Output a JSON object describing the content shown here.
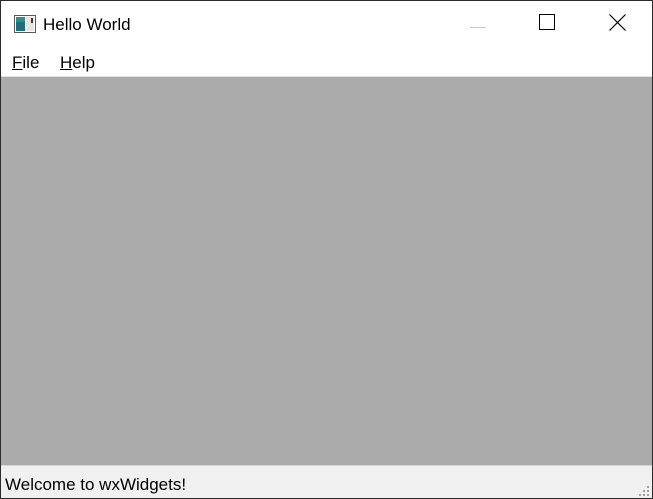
{
  "window": {
    "title": "Hello World",
    "app_icon": "app-window-icon",
    "controls": {
      "minimize_icon": "minimize-icon",
      "maximize_icon": "maximize-icon",
      "close_icon": "close-icon"
    }
  },
  "menubar": {
    "items": [
      {
        "mnemonic": "F",
        "rest": "ile"
      },
      {
        "mnemonic": "H",
        "rest": "elp"
      }
    ]
  },
  "client": {
    "background": "#ababab"
  },
  "statusbar": {
    "text": "Welcome to wxWidgets!",
    "grip_icon": "resize-grip-icon"
  }
}
